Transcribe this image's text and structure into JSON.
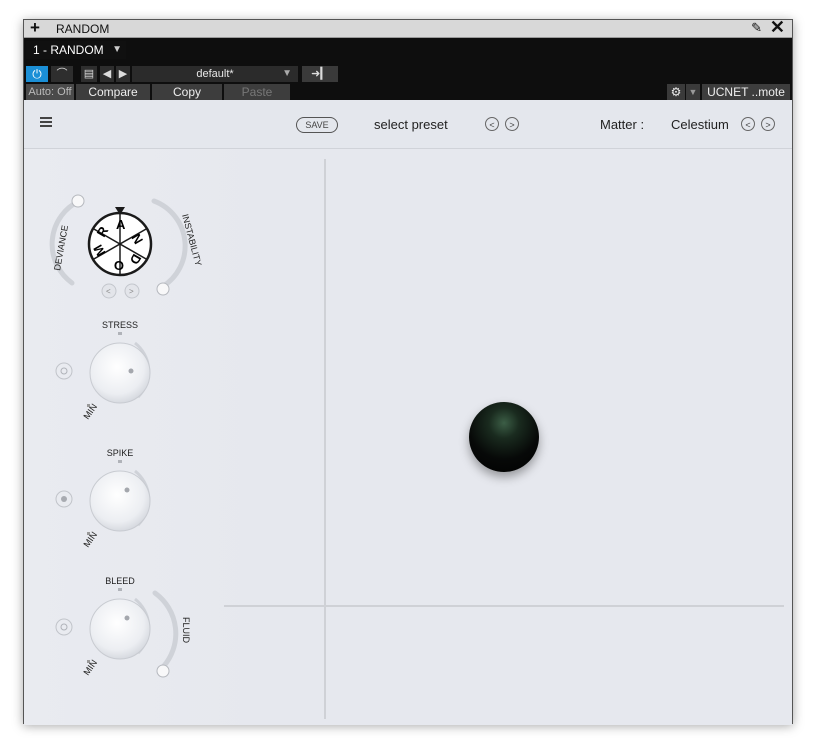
{
  "window": {
    "title": "RANDOM"
  },
  "host": {
    "instance": "1 - RANDOM",
    "preset_name": "default*",
    "auto_label": "Auto: Off",
    "compare_label": "Compare",
    "copy_label": "Copy",
    "paste_label": "Paste",
    "remote_label": "UCNET ..mote"
  },
  "plugin": {
    "save_label": "SAVE",
    "select_preset": "select preset",
    "prev_symbol": "<",
    "next_symbol": ">",
    "matter_label": "Matter :",
    "matter_value": "Celestium"
  },
  "dial": {
    "letters": [
      "R",
      "A",
      "N",
      "D",
      "O",
      "M"
    ],
    "deviance_label": "DEVIANCE",
    "instability_label": "INSTABILITY"
  },
  "knobs": [
    {
      "label": "STRESS",
      "min_label": "MIN"
    },
    {
      "label": "SPIKE",
      "min_label": "MIN"
    },
    {
      "label": "BLEED",
      "min_label": "MIN",
      "extra_label": "FLUID"
    }
  ],
  "colors": {
    "accent": "#1b8fd6",
    "background": "#e6e8ee",
    "host_bar": "#0e0e0e"
  }
}
